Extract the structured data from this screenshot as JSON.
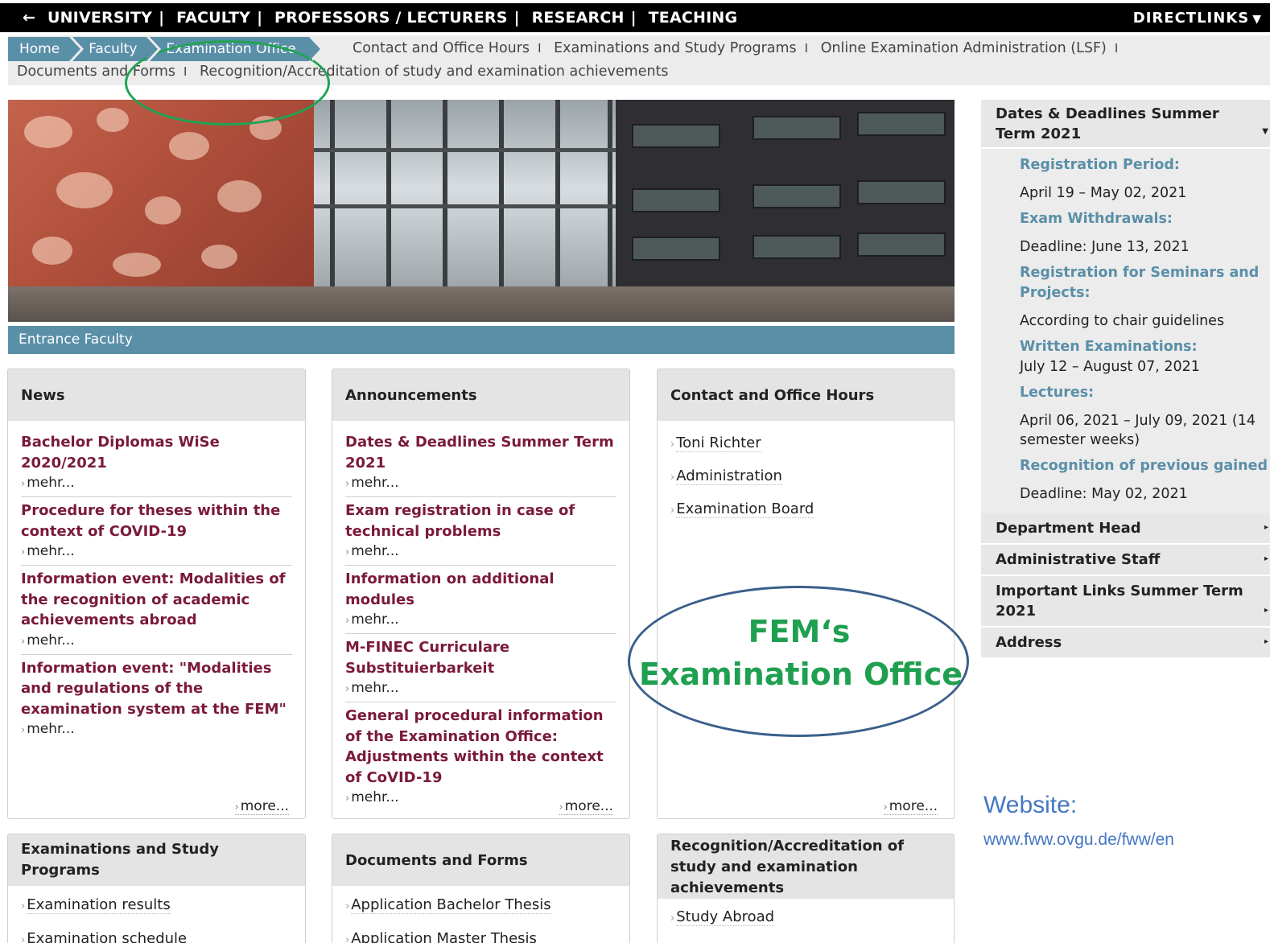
{
  "topnav": {
    "back_icon": "←",
    "items": [
      "UNIVERSITY",
      "FACULTY",
      "PROFESSORS / LECTURERS",
      "RESEARCH",
      "TEACHING"
    ],
    "directlinks": "DIRECTLINKS"
  },
  "breadcrumb": [
    "Home",
    "Faculty",
    "Examination Office"
  ],
  "sublinks": {
    "row1": [
      "Contact and Office Hours",
      "Examinations and Study Programs",
      "Online Examination Administration (LSF)"
    ],
    "row2": [
      "Documents and Forms",
      "Recognition/Accreditation of study and examination achievements"
    ]
  },
  "hero": {
    "caption": "Entrance Faculty"
  },
  "news": {
    "title": "News",
    "items": [
      {
        "title": "Bachelor Diplomas WiSe 2020/2021",
        "link": "mehr..."
      },
      {
        "title": "Procedure for theses within the context of COVID-19",
        "link": "mehr..."
      },
      {
        "title": "Information event: Modalities of the recognition of academic achievements abroad",
        "link": "mehr..."
      },
      {
        "title": "Information event: \"Modalities and regulations of the examination system at the FEM\"",
        "link": "mehr..."
      }
    ],
    "more": "more..."
  },
  "announcements": {
    "title": "Announcements",
    "items": [
      {
        "title": "Dates & Deadlines Summer Term 2021",
        "link": "mehr..."
      },
      {
        "title": "Exam registration in case of technical problems",
        "link": "mehr..."
      },
      {
        "title": "Information on additional modules",
        "link": "mehr..."
      },
      {
        "title": "M-FINEC Curriculare Substituierbarkeit",
        "link": "mehr..."
      },
      {
        "title": "General procedural information of the Examination Office: Adjustments within the context of CoVID-19",
        "link": "mehr..."
      }
    ],
    "more": "more..."
  },
  "contact": {
    "title": "Contact and Office Hours",
    "links": [
      "Toni Richter",
      "Administration",
      "Examination Board"
    ],
    "more": "more..."
  },
  "exams": {
    "title": "Examinations and Study Programs",
    "links": [
      "Examination results",
      "Examination schedule"
    ]
  },
  "documents": {
    "title": "Documents and Forms",
    "links": [
      "Application Bachelor Thesis",
      "Application Master Thesis"
    ]
  },
  "recognition": {
    "title": "Recognition/Accreditation of study and examination achievements",
    "links": [
      "Study Abroad"
    ]
  },
  "sidebar": {
    "dates_title": "Dates & Deadlines Summer Term 2021",
    "entries": [
      {
        "label": "Registration Period:",
        "value": "April 19 – May 02, 2021"
      },
      {
        "label": "Exam Withdrawals:",
        "value": "Deadline: June 13, 2021"
      },
      {
        "label": "Registration for Seminars and Projects:",
        "value": "According to chair guidelines"
      },
      {
        "label": "Written Examinations:",
        "value": "July 12 – August 07, 2021"
      },
      {
        "label": "Lectures:",
        "value": "April 06, 2021  – July 09, 2021 (14 semester weeks)"
      },
      {
        "label": "Recognition of previous gained credits and grades:",
        "value": "Deadline: May 02, 2021"
      }
    ],
    "sections": [
      "Department Head",
      "Administrative Staff",
      "Important Links Summer Term 2021",
      "Address"
    ]
  },
  "annotation": {
    "line1": "FEM‘s",
    "line2": "Examination Office",
    "website_label": "Website:",
    "website_url": "www.fww.ovgu.de/fww/en"
  },
  "colors": {
    "accent_blue": "#5a8fa8",
    "news_title": "#7a1a3a",
    "annotation_green": "#1fa050",
    "annotation_blue": "#3a5f8a",
    "website_blue": "#4477c4"
  }
}
